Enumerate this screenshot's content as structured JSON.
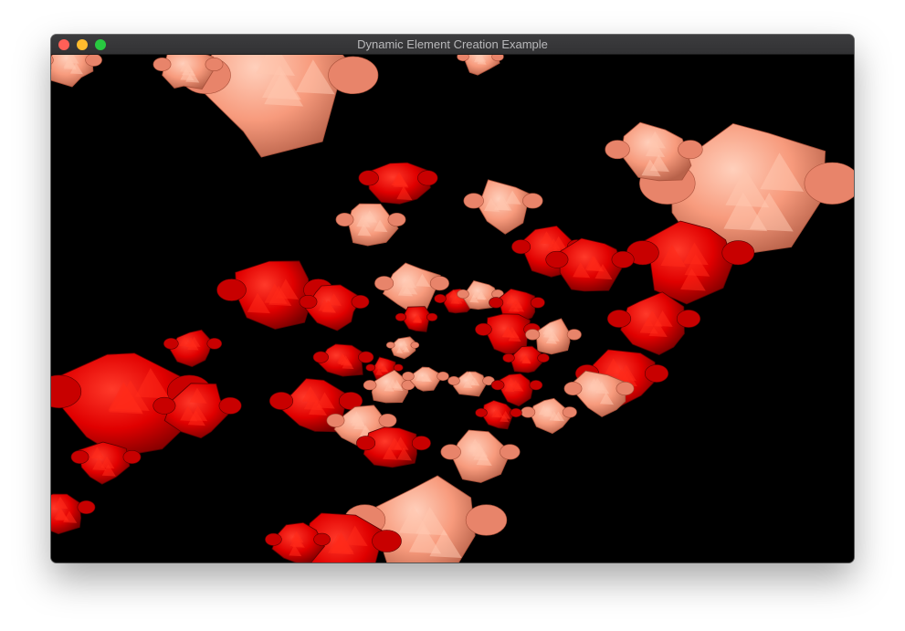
{
  "window": {
    "title": "Dynamic Element Creation Example",
    "buttons": {
      "close_color": "#ff5f57",
      "minimize_color": "#febc2e",
      "zoom_color": "#28c840"
    }
  },
  "scene": {
    "background_color": "#000000",
    "object_colors": {
      "red": "#ff0000",
      "salmon": "#ff8c69"
    },
    "object_shape": "monkey-head-mesh"
  }
}
